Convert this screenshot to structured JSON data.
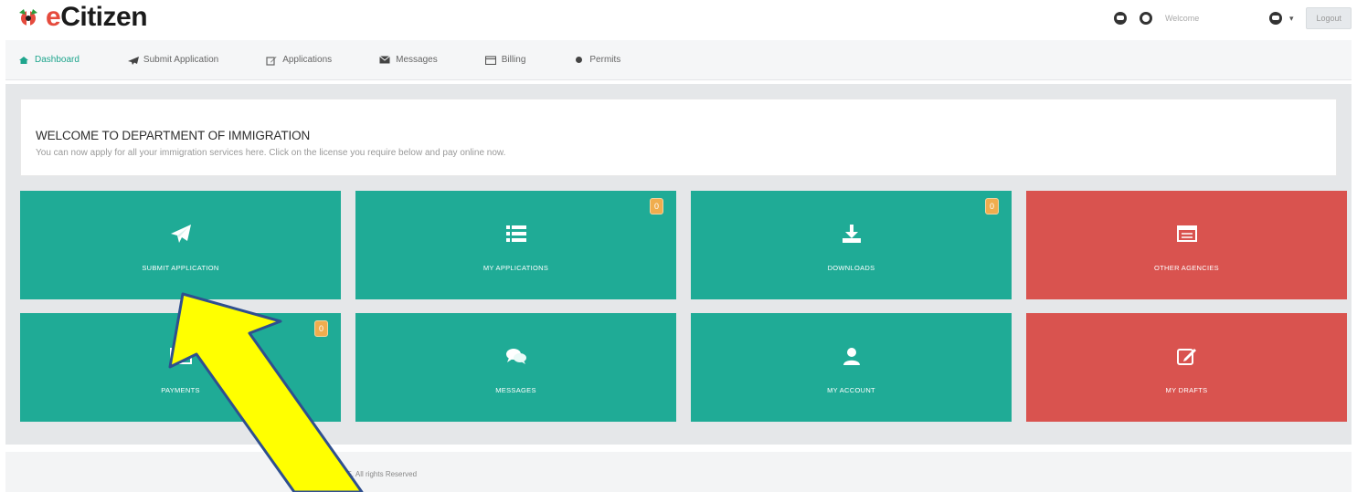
{
  "header": {
    "brand": {
      "prefix": "e",
      "name": "Citizen"
    },
    "welcome_text": "Welcome",
    "logout_label": "Logout"
  },
  "nav": {
    "items": [
      {
        "label": "Dashboard",
        "icon": "home-icon",
        "active": true
      },
      {
        "label": "Submit Application",
        "icon": "paper-plane-icon",
        "active": false
      },
      {
        "label": "Applications",
        "icon": "edit-icon",
        "active": false
      },
      {
        "label": "Messages",
        "icon": "envelope-icon",
        "active": false
      },
      {
        "label": "Billing",
        "icon": "calendar-icon",
        "active": false
      },
      {
        "label": "Permits",
        "icon": "circle-icon",
        "active": false
      }
    ]
  },
  "welcome": {
    "title": "WELCOME TO DEPARTMENT OF IMMIGRATION",
    "description": "You can now apply for all your immigration services here. Click on the license you require below and pay online now."
  },
  "tiles": [
    {
      "label": "SUBMIT APPLICATION",
      "icon": "paper-plane-icon",
      "color": "#1fab96",
      "badge": ""
    },
    {
      "label": "MY APPLICATIONS",
      "icon": "list-icon",
      "color": "#1fab96",
      "badge": "0"
    },
    {
      "label": "DOWNLOADS",
      "icon": "download-icon",
      "color": "#1fab96",
      "badge": "0"
    },
    {
      "label": "OTHER AGENCIES",
      "icon": "window-icon",
      "color": "#d9534f",
      "badge": ""
    },
    {
      "label": "PAYMENTS",
      "icon": "credit-card-icon",
      "color": "#1fab96",
      "badge": "0"
    },
    {
      "label": "MESSAGES",
      "icon": "comments-icon",
      "color": "#1fab96",
      "badge": ""
    },
    {
      "label": "MY ACCOUNT",
      "icon": "user-icon",
      "color": "#1fab96",
      "badge": ""
    },
    {
      "label": "MY DRAFTS",
      "icon": "edit-icon",
      "color": "#d9534f",
      "badge": ""
    }
  ],
  "footer": {
    "text": "eCitizen 2015. All rights Reserved"
  },
  "colors": {
    "accent_green": "#1fab96",
    "accent_red": "#d9534f",
    "badge_orange": "#f0ad4e",
    "annotation_arrow": "#ffff00"
  }
}
